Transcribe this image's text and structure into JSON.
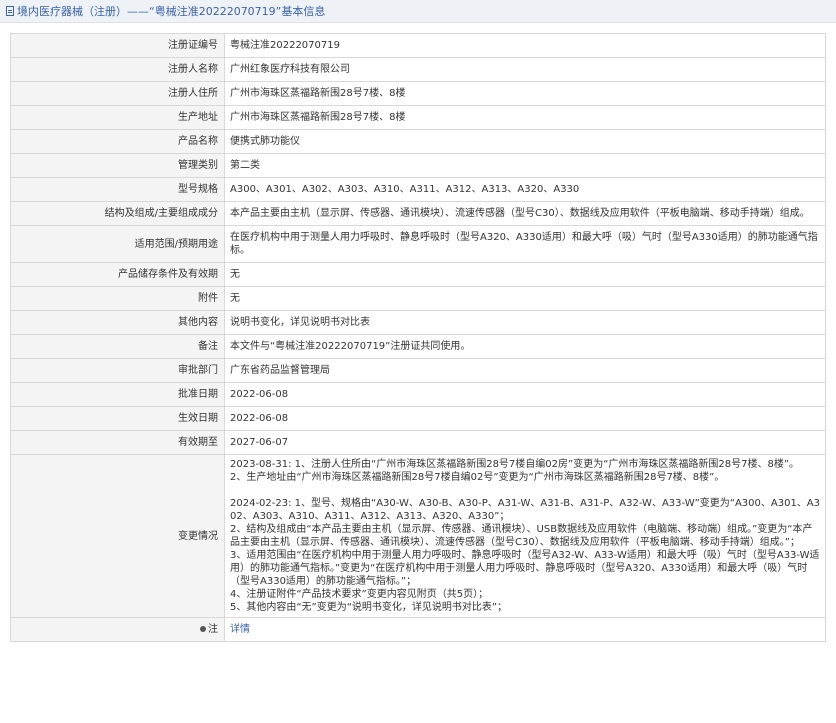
{
  "header": {
    "title": "境内医疗器械（注册）——“粤械注准20222070719”基本信息"
  },
  "rows": [
    {
      "label": "注册证编号",
      "value": "粤械注准20222070719"
    },
    {
      "label": "注册人名称",
      "value": "广州红象医疗科技有限公司"
    },
    {
      "label": "注册人住所",
      "value": "广州市海珠区蒸福路新围28号7楼、8楼"
    },
    {
      "label": "生产地址",
      "value": "广州市海珠区蒸福路新围28号7楼、8楼"
    },
    {
      "label": "产品名称",
      "value": "便携式肺功能仪"
    },
    {
      "label": "管理类别",
      "value": "第二类"
    },
    {
      "label": "型号规格",
      "value": "A300、A301、A302、A303、A310、A311、A312、A313、A320、A330"
    },
    {
      "label": "结构及组成/主要组成成分",
      "value": "本产品主要由主机（显示屏、传感器、通讯模块）、流速传感器（型号C30）、数据线及应用软件（平板电脑端、移动手持端）组成。"
    },
    {
      "label": "适用范围/预期用途",
      "value": "在医疗机构中用于测量人用力呼吸时、静息呼吸时（型号A320、A330适用）和最大呼（吸）气时（型号A330适用）的肺功能通气指标。"
    },
    {
      "label": "产品储存条件及有效期",
      "value": "无"
    },
    {
      "label": "附件",
      "value": "无"
    },
    {
      "label": "其他内容",
      "value": "说明书变化，详见说明书对比表"
    },
    {
      "label": "备注",
      "value": "本文件与“粤械注准20222070719”注册证共同使用。"
    },
    {
      "label": "审批部门",
      "value": "广东省药品监督管理局"
    },
    {
      "label": "批准日期",
      "value": "2022-06-08"
    },
    {
      "label": "生效日期",
      "value": "2022-06-08"
    },
    {
      "label": "有效期至",
      "value": "2027-06-07"
    }
  ],
  "change": {
    "label": "变更情况",
    "lines": [
      "2023-08-31: 1、注册人住所由“广州市海珠区蒸福路新围28号7楼自编02房”变更为“广州市海珠区蒸福路新围28号7楼、8楼”。",
      "2、生产地址由“广州市海珠区蒸福路新围28号7楼自编02号”变更为“广州市海珠区蒸福路新围28号7楼、8楼”。",
      "",
      "2024-02-23: 1、型号、规格由“A30-W、A30-B、A30-P、A31-W、A31-B、A31-P、A32-W、A33-W”变更为“A300、A301、A302、A303、A310、A311、A312、A313、A320、A330”；",
      "2、结构及组成由“本产品主要由主机（显示屏、传感器、通讯模块）、USB数据线及应用软件（电脑端、移动端）组成。”变更为“本产品主要由主机（显示屏、传感器、通讯模块）、流速传感器（型号C30）、数据线及应用软件（平板电脑端、移动手持端）组成。”；",
      "3、适用范围由“在医疗机构中用于测量人用力呼吸时、静息呼吸时（型号A32-W、A33-W适用）和最大呼（吸）气时（型号A33-W适用）的肺功能通气指标。”变更为“在医疗机构中用于测量人用力呼吸时、静息呼吸时（型号A320、A330适用）和最大呼（吸）气时（型号A330适用）的肺功能通气指标。”；",
      "4、注册证附件“产品技术要求”变更内容见附页（共5页）；",
      "5、其他内容由“无”变更为“说明书变化，详见说明书对比表”；"
    ]
  },
  "note": {
    "label": "注",
    "link_text": "详情",
    "icon": "pin-icon"
  }
}
